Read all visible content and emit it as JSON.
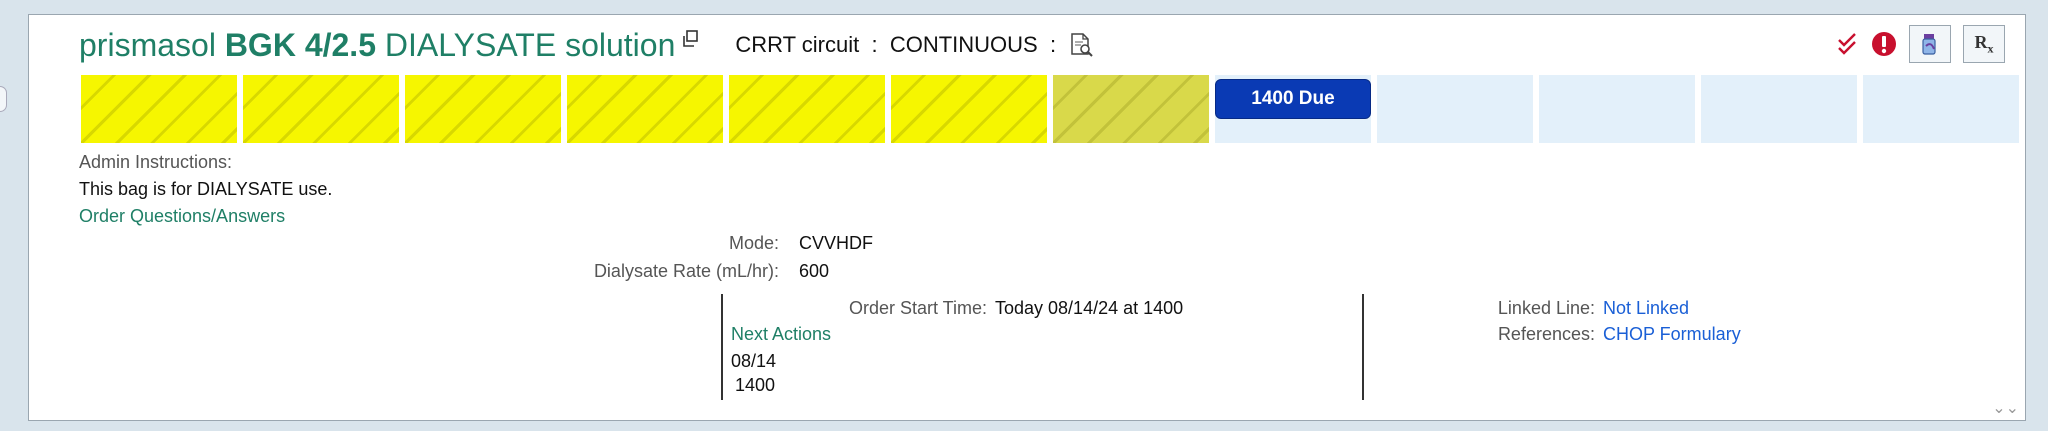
{
  "order": {
    "name_part1": "prismasol",
    "name_bold": "BGK 4/2.5",
    "name_part2": "DIALYSATE solution",
    "circuit_label": "CRRT circuit",
    "sep1": ":",
    "frequency": "CONTINUOUS",
    "sep2": ":"
  },
  "timeline": {
    "slots": [
      "given",
      "given",
      "given",
      "given",
      "given",
      "given",
      "given-dim",
      "due",
      "empty",
      "empty",
      "empty",
      "empty"
    ],
    "due_label": "1400 Due"
  },
  "admin": {
    "heading": "Admin Instructions:",
    "text": "This bag is for DIALYSATE use.",
    "questions_link": "Order Questions/Answers"
  },
  "details": {
    "mode_label": "Mode:",
    "mode_value": "CVVHDF",
    "rate_label": "Dialysate Rate (mL/hr):",
    "rate_value": "600",
    "start_label": "Order Start Time:",
    "start_value": "Today 08/14/24 at 1400",
    "next_actions_label": "Next Actions",
    "next_date": "08/14",
    "next_time": "1400",
    "linked_line_label": "Linked Line:",
    "linked_line_value": "Not Linked",
    "references_label": "References:",
    "references_value": "CHOP Formulary"
  },
  "icons": {
    "verify": "double-check-icon",
    "alert": "exclamation-alert-icon",
    "pharmacy": "medication-bottle-icon",
    "rx": "rx-icon"
  },
  "colors": {
    "title_green": "#1f7f66",
    "due_blue": "#0a3ab4",
    "given_yellow": "#f6f600",
    "empty_blue": "#e3f0fa",
    "link_blue": "#1a5fd6",
    "alert_red": "#c8102e"
  }
}
